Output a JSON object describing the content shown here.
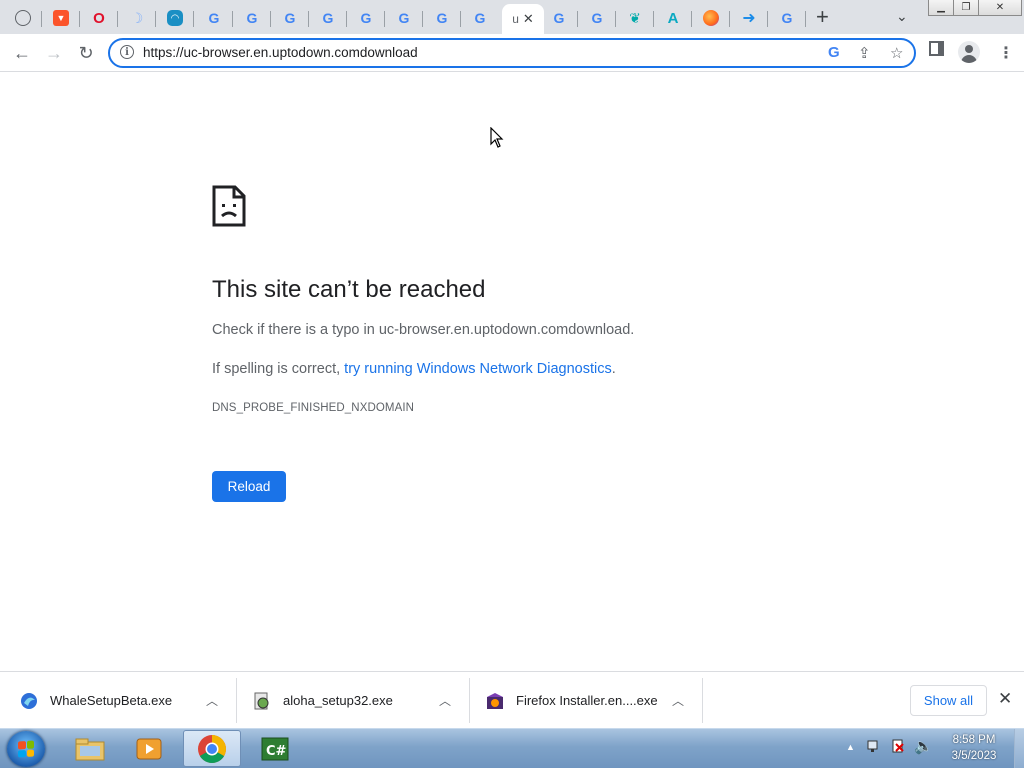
{
  "tabs": [
    {
      "icon": "globe-icon"
    },
    {
      "icon": "brave-icon"
    },
    {
      "icon": "opera-icon"
    },
    {
      "icon": "moon-icon"
    },
    {
      "icon": "ghost-icon"
    },
    {
      "icon": "google-icon"
    },
    {
      "icon": "google-icon"
    },
    {
      "icon": "google-icon"
    },
    {
      "icon": "google-icon"
    },
    {
      "icon": "google-icon"
    },
    {
      "icon": "google-icon"
    },
    {
      "icon": "google-icon"
    },
    {
      "icon": "active-tab",
      "label": "u",
      "active": true
    },
    {
      "icon": "google-icon"
    },
    {
      "icon": "google-icon"
    },
    {
      "icon": "feather-icon"
    },
    {
      "icon": "alpha-icon"
    },
    {
      "icon": "firefox-icon"
    },
    {
      "icon": "download-arrow-icon"
    },
    {
      "icon": "google-icon"
    }
  ],
  "omnibox": {
    "url": "https://uc-browser.en.uptodown.comdownload"
  },
  "error": {
    "title": "This site can’t be reached",
    "line1": "Check if there is a typo in uc-browser.en.uptodown.comdownload.",
    "line2_prefix": "If spelling is correct, ",
    "line2_link": "try running Windows Network Diagnostics",
    "line2_suffix": ".",
    "code": "DNS_PROBE_FINISHED_NXDOMAIN",
    "reload_label": "Reload"
  },
  "downloads": {
    "items": [
      {
        "name": "WhaleSetupBeta.exe",
        "icon": "whale-icon"
      },
      {
        "name": "aloha_setup32.exe",
        "icon": "installer-icon"
      },
      {
        "name": "Firefox Installer.en....exe",
        "icon": "firefox-installer-icon"
      }
    ],
    "show_all_label": "Show all"
  },
  "taskbar": {
    "time": "8:58 PM",
    "date": "3/5/2023",
    "apps": [
      "explorer",
      "media-player",
      "chrome",
      "csharp-ide"
    ]
  },
  "colors": {
    "accent": "#1a73e8",
    "tabstrip": "#dee1e6",
    "taskbar": "#7fa3c9"
  }
}
